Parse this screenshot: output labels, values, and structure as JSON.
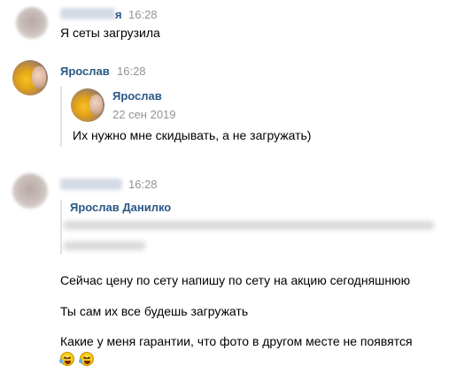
{
  "messages": [
    {
      "author_visible_tail": "я",
      "time": "16:28",
      "text": "Я сеты загрузила"
    },
    {
      "author": "Ярослав",
      "time": "16:28",
      "forwarded": {
        "author": "Ярослав",
        "date": "22 сен 2019",
        "text": "Их нужно мне скидывать, а не загружать)"
      }
    },
    {
      "time": "16:28",
      "reply": {
        "author": "Ярослав Данилко"
      },
      "lines": [
        "Сейчас цену по сету напишу по сету на акцию сегодняшнюю",
        "Ты сам их все будешь загружать",
        "Какие у меня гарантии, что фото в другом месте не появятся"
      ],
      "emoji": [
        "rolling-on-floor-laughing-emoji",
        "rolling-on-floor-laughing-emoji"
      ]
    }
  ],
  "colors": {
    "author_link": "#2a5885",
    "timestamp": "#939393",
    "forward_bar": "#dfe4ea"
  }
}
